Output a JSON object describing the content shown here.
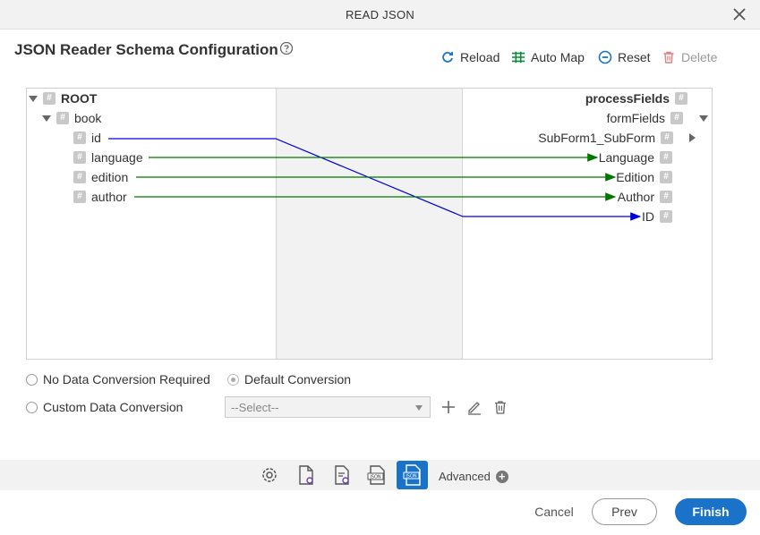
{
  "window": {
    "title": "READ JSON"
  },
  "header": {
    "title": "JSON Reader Schema Configuration"
  },
  "toolbar": {
    "reload": "Reload",
    "automap": "Auto Map",
    "reset": "Reset",
    "delete": "Delete"
  },
  "source_tree": {
    "root": "ROOT",
    "book": "book",
    "fields": [
      "id",
      "language",
      "edition",
      "author"
    ]
  },
  "target_tree": {
    "root": "processFields",
    "formfields": "formFields",
    "subform": "SubForm1_SubForm",
    "fields": [
      "Language",
      "Edition",
      "Author",
      "ID"
    ]
  },
  "mappings": [
    {
      "from": "id",
      "to": "ID",
      "color": "#0000dd"
    },
    {
      "from": "language",
      "to": "Language",
      "color": "#007700"
    },
    {
      "from": "edition",
      "to": "Edition",
      "color": "#007700"
    },
    {
      "from": "author",
      "to": "Author",
      "color": "#007700"
    }
  ],
  "conversion": {
    "no_conversion": "No Data Conversion Required",
    "default_conversion": "Default Conversion",
    "custom_conversion": "Custom Data Conversion",
    "select_value": "--Select--"
  },
  "steps": {
    "advanced": "Advanced"
  },
  "footer": {
    "cancel": "Cancel",
    "prev": "Prev",
    "finish": "Finish"
  },
  "colors": {
    "accent": "#1a73c9",
    "map_blue": "#0000dd",
    "map_green": "#007700"
  }
}
